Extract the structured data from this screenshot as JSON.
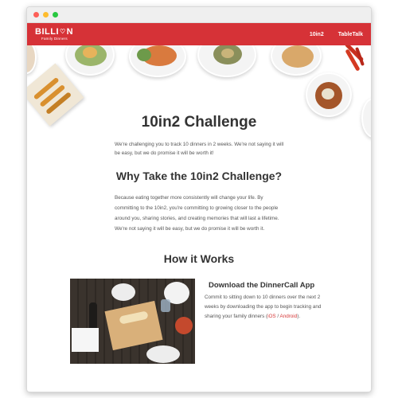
{
  "colors": {
    "brand_red": "#d63237",
    "dot_red": "#fd5f57",
    "dot_yellow": "#febc2e",
    "dot_green": "#28c840",
    "link": "#d63838"
  },
  "navbar": {
    "logo_main_left": "BILLI",
    "logo_main_right": "N",
    "logo_sub": "Family Dinners",
    "links": [
      "10in2",
      "TableTalk"
    ]
  },
  "main": {
    "title": "10in2 Challenge",
    "intro": "We're challenging you to track 10 dinners in 2 weeks. We're not saying it will be easy, but we do promise it will be worth it!",
    "why_heading": "Why Take the 10in2 Challenge?",
    "why_body": "Because eating together more consistently will change your life. By committing to the 10in2, you're committing to growing closer to the people around you, sharing stories, and creating memories that will last a lifetime. We're not saying it will be easy, but we do promise it will be worth it.",
    "how_heading": "How it Works",
    "download_title": "Download the DinnerCall App",
    "download_text": "Commit to sitting down to 10 dinners over the next 2 weeks by downloading the app to begin tracking and sharing your family dinners (",
    "ios_link": "iOS",
    "separator": " / ",
    "android_link": "Android",
    "closing": ")."
  }
}
